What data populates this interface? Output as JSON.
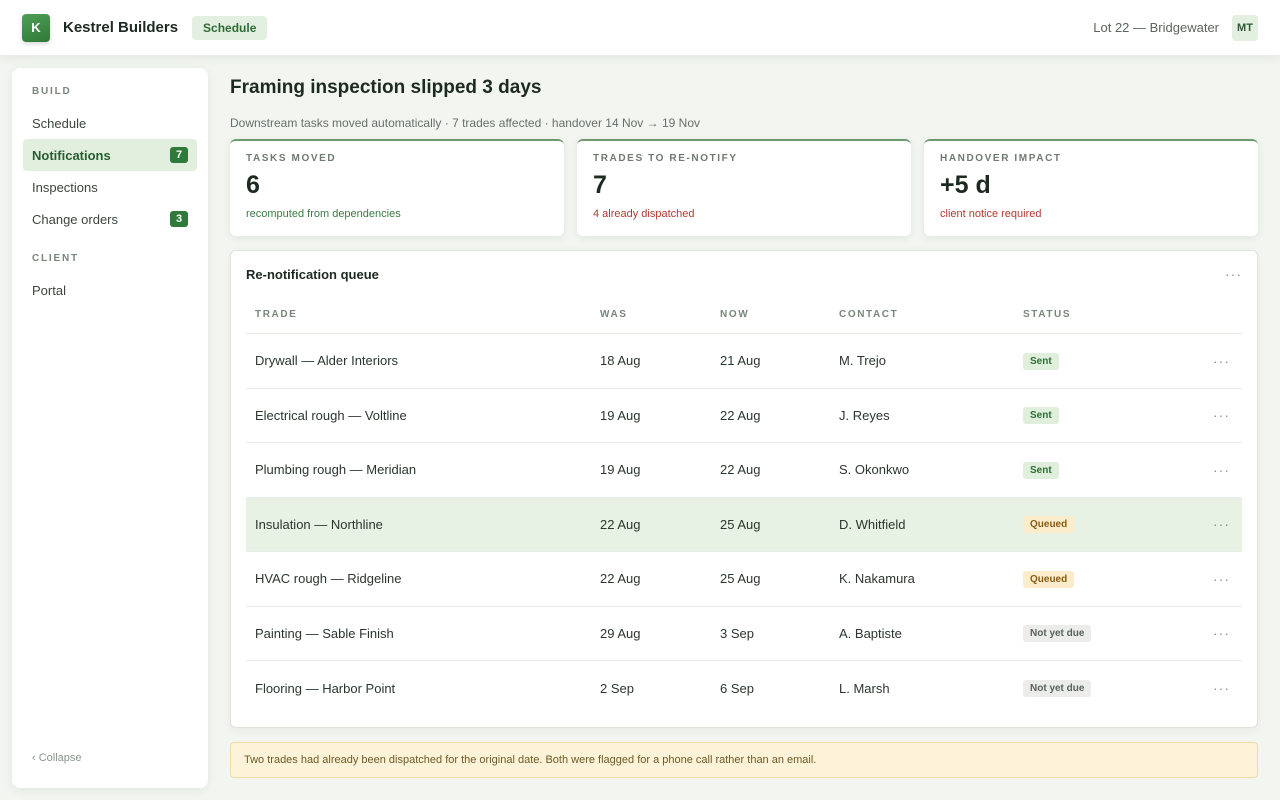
{
  "header": {
    "logo_letter": "K",
    "app_name": "Kestrel Builders",
    "module_pill": "Schedule",
    "project": "Lot 22 — Bridgewater",
    "avatar_initials": "MT"
  },
  "sidebar": {
    "section_build": "BUILD",
    "items": [
      {
        "label": "Schedule",
        "badge": ""
      },
      {
        "label": "Notifications",
        "badge": "7"
      },
      {
        "label": "Inspections",
        "badge": ""
      },
      {
        "label": "Change orders",
        "badge": "3"
      }
    ],
    "section_client": "CLIENT",
    "client_items": [
      {
        "label": "Portal"
      }
    ],
    "collapse_label": "‹ Collapse"
  },
  "main": {
    "title": "Framing inspection slipped 3 days",
    "subtitle": "Downstream tasks moved automatically · 7 trades affected · handover 14 Nov → 19 Nov",
    "kpis": [
      {
        "label": "TASKS MOVED",
        "value": "6",
        "note": "recomputed from dependencies"
      },
      {
        "label": "TRADES TO RE-NOTIFY",
        "value": "7",
        "note": "4 already dispatched"
      },
      {
        "label": "HANDOVER IMPACT",
        "value": "+5 d",
        "note": "client notice required"
      }
    ],
    "queue": {
      "title": "Re-notification queue",
      "more": "···",
      "columns": {
        "trade": "TRADE",
        "was": "WAS",
        "now": "NOW",
        "contact": "CONTACT",
        "status": "STATUS"
      },
      "rows": [
        {
          "trade": "Drywall — Alder Interiors",
          "was": "18 Aug",
          "now": "21 Aug",
          "contact": "M. Trejo",
          "status": "Sent"
        },
        {
          "trade": "Electrical rough — Voltline",
          "was": "19 Aug",
          "now": "22 Aug",
          "contact": "J. Reyes",
          "status": "Sent"
        },
        {
          "trade": "Plumbing rough — Meridian",
          "was": "19 Aug",
          "now": "22 Aug",
          "contact": "S. Okonkwo",
          "status": "Sent"
        },
        {
          "trade": "Insulation — Northline",
          "was": "22 Aug",
          "now": "25 Aug",
          "contact": "D. Whitfield",
          "status": "Queued"
        },
        {
          "trade": "HVAC rough — Ridgeline",
          "was": "22 Aug",
          "now": "25 Aug",
          "contact": "K. Nakamura",
          "status": "Queued"
        },
        {
          "trade": "Painting — Sable Finish",
          "was": "29 Aug",
          "now": "3 Sep",
          "contact": "A. Baptiste",
          "status": "Not yet due"
        },
        {
          "trade": "Flooring — Harbor Point",
          "was": "2 Sep",
          "now": "6 Sep",
          "contact": "L. Marsh",
          "status": "Not yet due"
        }
      ],
      "row_more": "···"
    },
    "banner": "Two trades had already been dispatched for the original date. Both were flagged for a phone call rather than an email."
  },
  "colors": {
    "accent": "#2e7a3a",
    "sent": "#e0efdc",
    "queued": "#fbeccb",
    "not_yet_due": "#ececea",
    "alert_note": "#b23b32"
  }
}
